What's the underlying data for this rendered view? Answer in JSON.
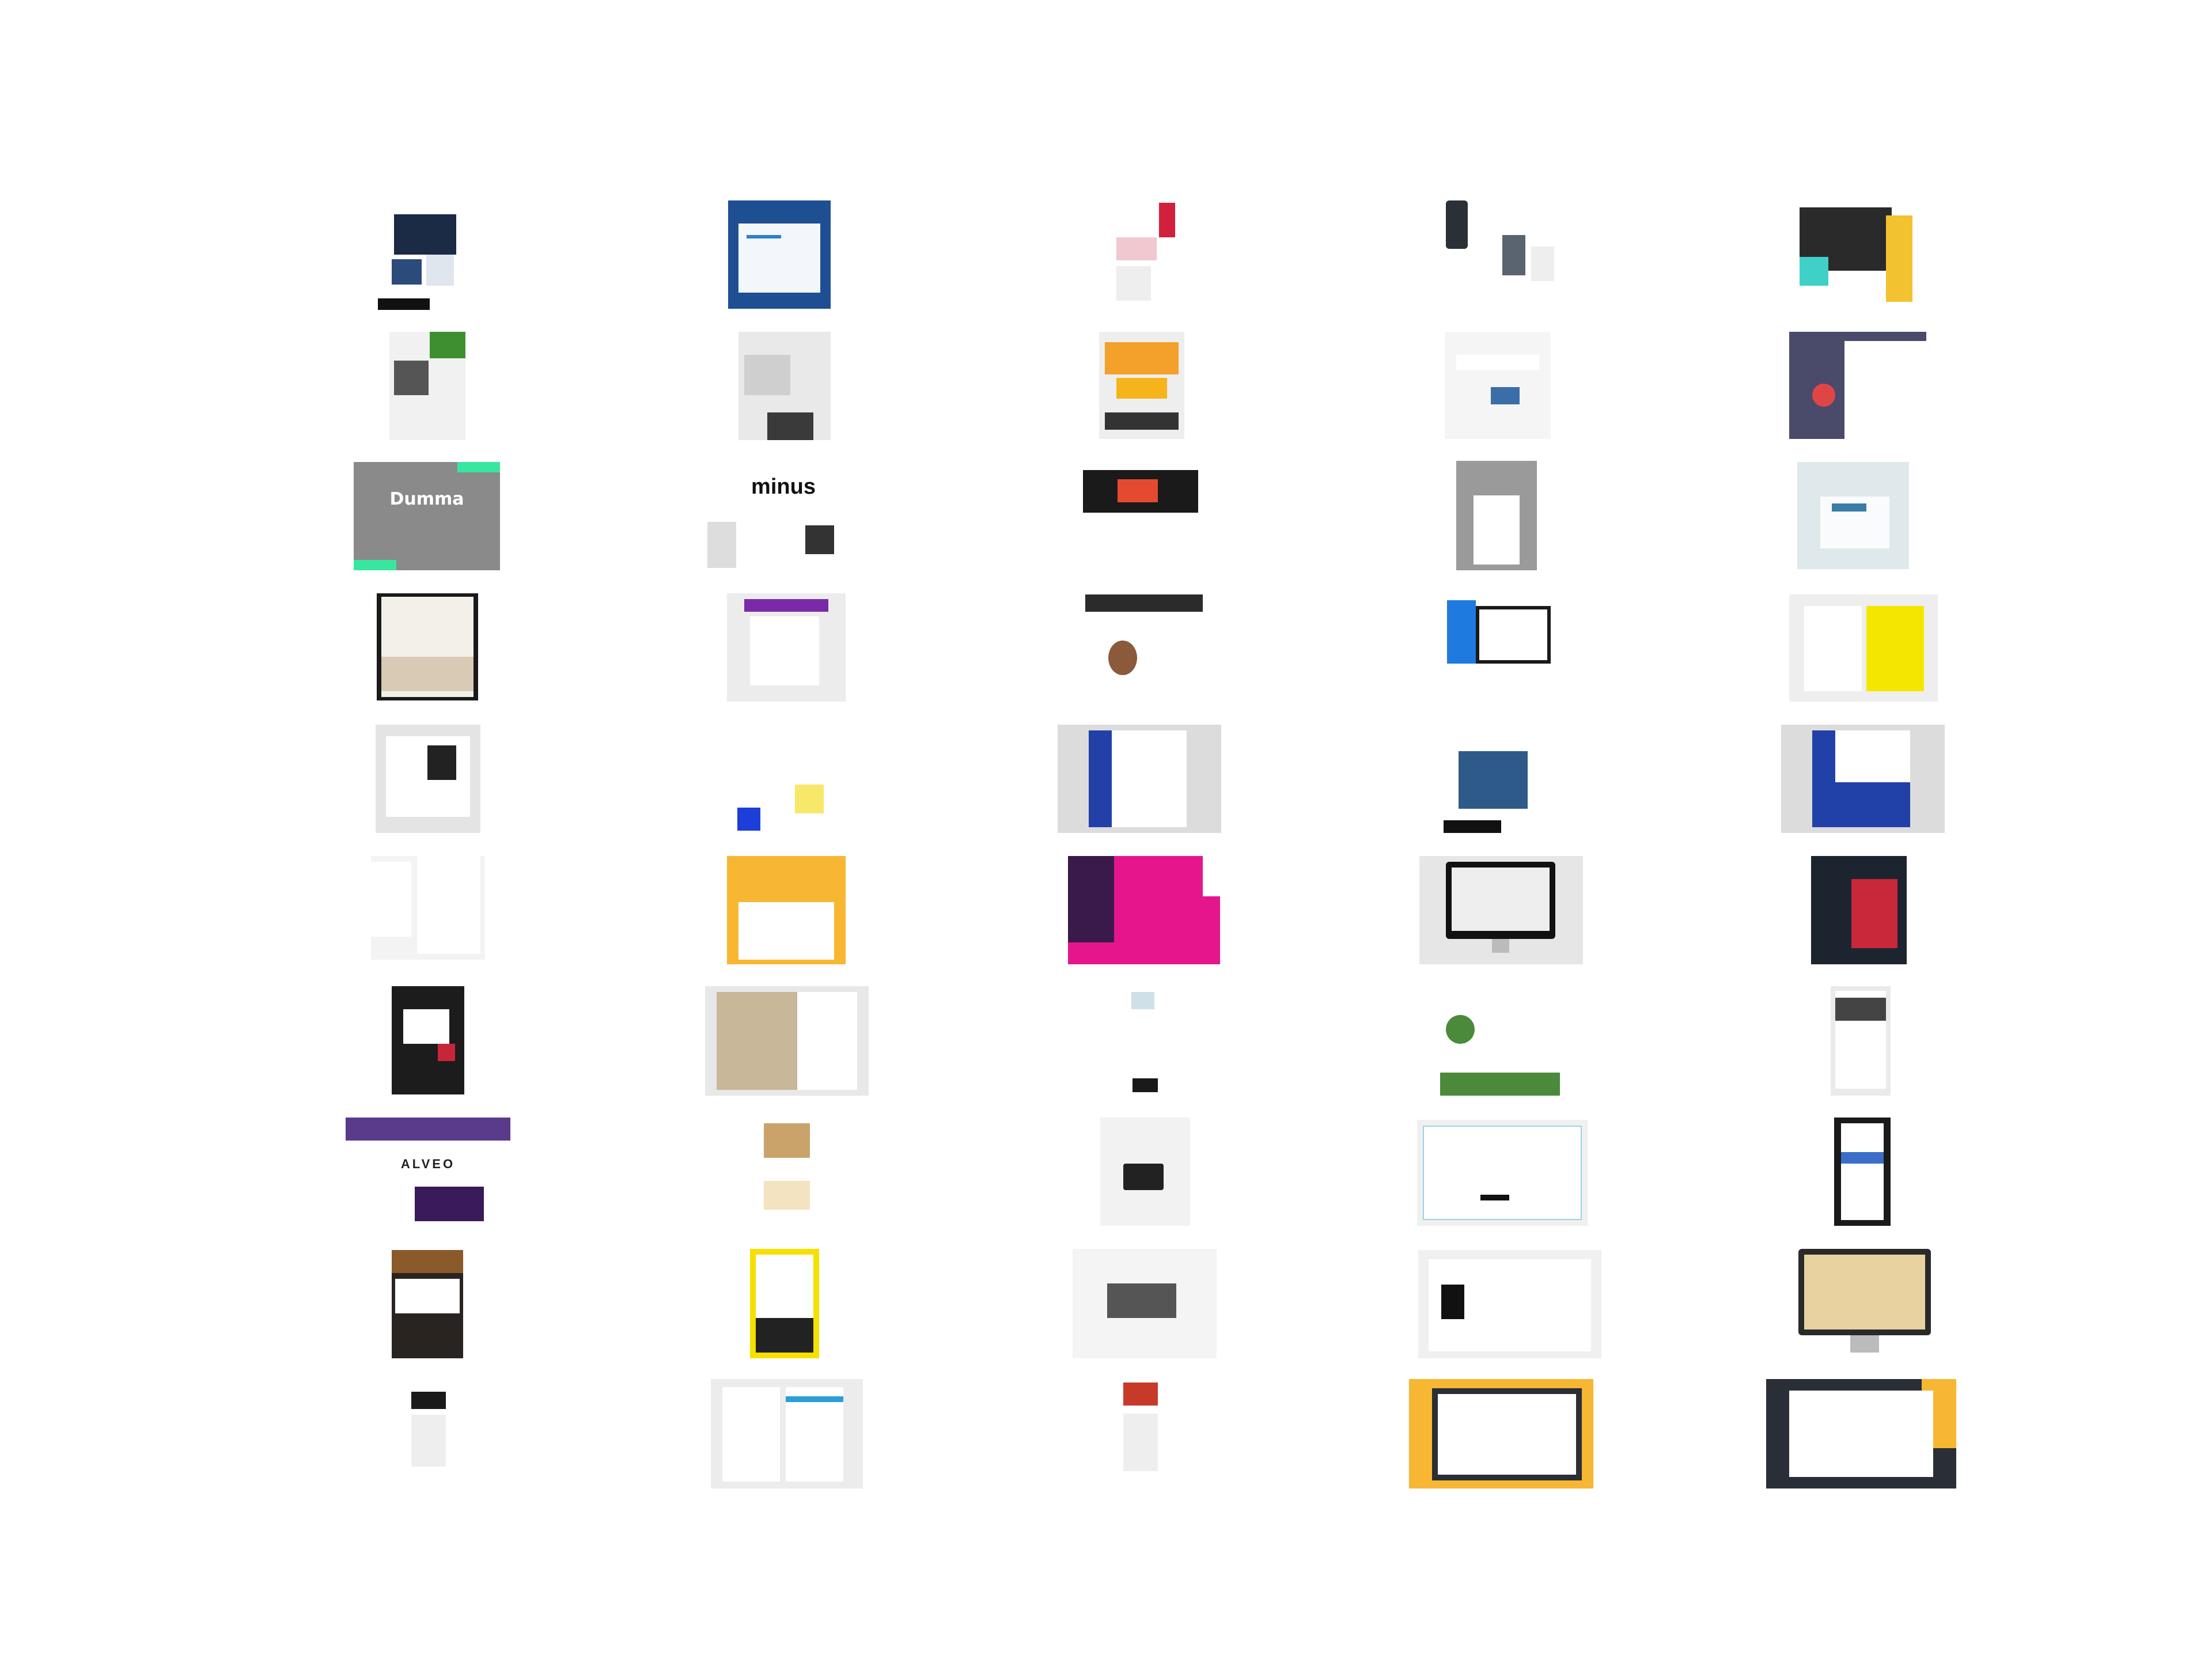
{
  "gallery": {
    "thumbnails": [
      {
        "name": "thumb-r1c1",
        "bg": "#ffffff",
        "accent": "#1b2a45",
        "label": ""
      },
      {
        "name": "thumb-r1c2",
        "bg": "#1f4f93",
        "accent": "#ffffff",
        "label": ""
      },
      {
        "name": "thumb-r1c3",
        "bg": "#ffffff",
        "accent": "#d21f3c",
        "label": ""
      },
      {
        "name": "thumb-r1c4",
        "bg": "#ffffff",
        "accent": "#333a44",
        "label": ""
      },
      {
        "name": "thumb-r1c5",
        "bg": "#2a2a2a",
        "accent": "#f2c230",
        "label": ""
      },
      {
        "name": "thumb-r2c1",
        "bg": "#f1f1f1",
        "accent": "#3e8f2f",
        "label": ""
      },
      {
        "name": "thumb-r2c2",
        "bg": "#e9e9e9",
        "accent": "#3a3a3a",
        "label": ""
      },
      {
        "name": "thumb-r2c3",
        "bg": "#eeeeee",
        "accent": "#f5b41a",
        "label": ""
      },
      {
        "name": "thumb-r2c4",
        "bg": "#f5f5f5",
        "accent": "#3b6ea8",
        "label": ""
      },
      {
        "name": "thumb-r2c5",
        "bg": "#4a4a6a",
        "accent": "#e04545",
        "label": ""
      },
      {
        "name": "thumb-r3c1",
        "bg": "#8a8a8a",
        "accent": "#39e6a0",
        "label": "Dumma"
      },
      {
        "name": "thumb-r3c2",
        "bg": "#ffffff",
        "accent": "#111111",
        "label": "minus"
      },
      {
        "name": "thumb-r3c3",
        "bg": "#ffffff",
        "accent": "#e34a2f",
        "label": ""
      },
      {
        "name": "thumb-r3c4",
        "bg": "#9a9a9a",
        "accent": "#222222",
        "label": ""
      },
      {
        "name": "thumb-r3c5",
        "bg": "#dfe9ec",
        "accent": "#3a7ea8",
        "label": ""
      },
      {
        "name": "thumb-r4c1",
        "bg": "#1a1a1a",
        "accent": "#f3f0ea",
        "label": ""
      },
      {
        "name": "thumb-r4c2",
        "bg": "#ececec",
        "accent": "#7a2aa8",
        "label": ""
      },
      {
        "name": "thumb-r4c3",
        "bg": "#2b2b2b",
        "accent": "#8a5a3a",
        "label": ""
      },
      {
        "name": "thumb-r4c4",
        "bg": "#ffffff",
        "accent": "#1f7ae0",
        "label": ""
      },
      {
        "name": "thumb-r4c5",
        "bg": "#eeeeee",
        "accent": "#f5e600",
        "label": ""
      },
      {
        "name": "thumb-r5c1",
        "bg": "#e4e4e4",
        "accent": "#222222",
        "label": ""
      },
      {
        "name": "thumb-r5c2",
        "bg": "#ffffff",
        "accent": "#1d3ed8",
        "label": ""
      },
      {
        "name": "thumb-r5c3",
        "bg": "#dcdcdc",
        "accent": "#2141a8",
        "label": ""
      },
      {
        "name": "thumb-r5c4",
        "bg": "#ffffff",
        "accent": "#2e5a8a",
        "label": ""
      },
      {
        "name": "thumb-r5c5",
        "bg": "#dcdcdc",
        "accent": "#2141a8",
        "label": ""
      },
      {
        "name": "thumb-r6c1",
        "bg": "#f3f3f3",
        "accent": "#b7c4d0",
        "label": ""
      },
      {
        "name": "thumb-r6c2",
        "bg": "#f7b733",
        "accent": "#ffffff",
        "label": ""
      },
      {
        "name": "thumb-r6c3",
        "bg": "#e5168c",
        "accent": "#3a1a4a",
        "label": ""
      },
      {
        "name": "thumb-r6c4",
        "bg": "#e6e6e6",
        "accent": "#111111",
        "label": ""
      },
      {
        "name": "thumb-r6c5",
        "bg": "#1c2430",
        "accent": "#c8283a",
        "label": ""
      },
      {
        "name": "thumb-r7c1",
        "bg": "#1c1c1c",
        "accent": "#c7263a",
        "label": ""
      },
      {
        "name": "thumb-r7c2",
        "bg": "#e8e8e8",
        "accent": "#c9b79a",
        "label": ""
      },
      {
        "name": "thumb-r7c3",
        "bg": "#ffffff",
        "accent": "#1a1a1a",
        "label": ""
      },
      {
        "name": "thumb-r7c4",
        "bg": "#ffffff",
        "accent": "#4b8a3a",
        "label": ""
      },
      {
        "name": "thumb-r7c5",
        "bg": "#eaeaea",
        "accent": "#444444",
        "label": ""
      },
      {
        "name": "thumb-r8c1",
        "bg": "#ffffff",
        "accent": "#5a3a8a",
        "label": "ALVEO"
      },
      {
        "name": "thumb-r8c2",
        "bg": "#ffffff",
        "accent": "#c9a36a",
        "label": ""
      },
      {
        "name": "thumb-r8c3",
        "bg": "#f2f2f2",
        "accent": "#222222",
        "label": ""
      },
      {
        "name": "thumb-r8c4",
        "bg": "#f0f0f0",
        "accent": "#9ad3e8",
        "label": ""
      },
      {
        "name": "thumb-r8c5",
        "bg": "#1a1a1a",
        "accent": "#3a6ec8",
        "label": ""
      },
      {
        "name": "thumb-r9c1",
        "bg": "#2a2420",
        "accent": "#8a5a2a",
        "label": ""
      },
      {
        "name": "thumb-r9c2",
        "bg": "#f5e000",
        "accent": "#222222",
        "label": ""
      },
      {
        "name": "thumb-r9c3",
        "bg": "#f4f4f4",
        "accent": "#555555",
        "label": ""
      },
      {
        "name": "thumb-r9c4",
        "bg": "#f0f0f0",
        "accent": "#111111",
        "label": ""
      },
      {
        "name": "thumb-r9c5",
        "bg": "#2a2a2a",
        "accent": "#e8d2a0",
        "label": ""
      },
      {
        "name": "thumb-r10c1",
        "bg": "#ffffff",
        "accent": "#1a1a1a",
        "label": ""
      },
      {
        "name": "thumb-r10c2",
        "bg": "#ececec",
        "accent": "#2a9fd6",
        "label": ""
      },
      {
        "name": "thumb-r10c3",
        "bg": "#ffffff",
        "accent": "#c73a2a",
        "label": ""
      },
      {
        "name": "thumb-r10c4",
        "bg": "#f7b733",
        "accent": "#2a2e36",
        "label": ""
      },
      {
        "name": "thumb-r10c5",
        "bg": "#2a2e36",
        "accent": "#f7b733",
        "label": ""
      }
    ]
  }
}
